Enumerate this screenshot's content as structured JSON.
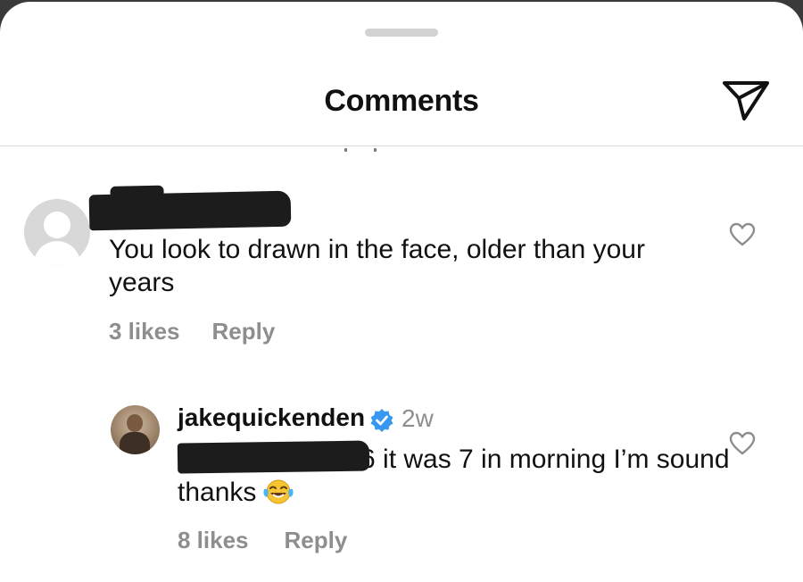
{
  "header": {
    "title": "Comments"
  },
  "comments": [
    {
      "username": "",
      "text": "You look to drawn in the face, older than your years",
      "likes": "3 likes",
      "reply_label": "Reply"
    }
  ],
  "replies": [
    {
      "username": "jakequickenden",
      "verified": true,
      "time": "2w",
      "mention_tail": "6",
      "text": " it was 7 in morning I’m sound thanks",
      "emoji": "face-with-tears-of-joy",
      "likes": "8 likes",
      "reply_label": "Reply"
    }
  ],
  "colors": {
    "text": "#111111",
    "secondary": "#8e8e8e",
    "verified": "#3897f0"
  }
}
